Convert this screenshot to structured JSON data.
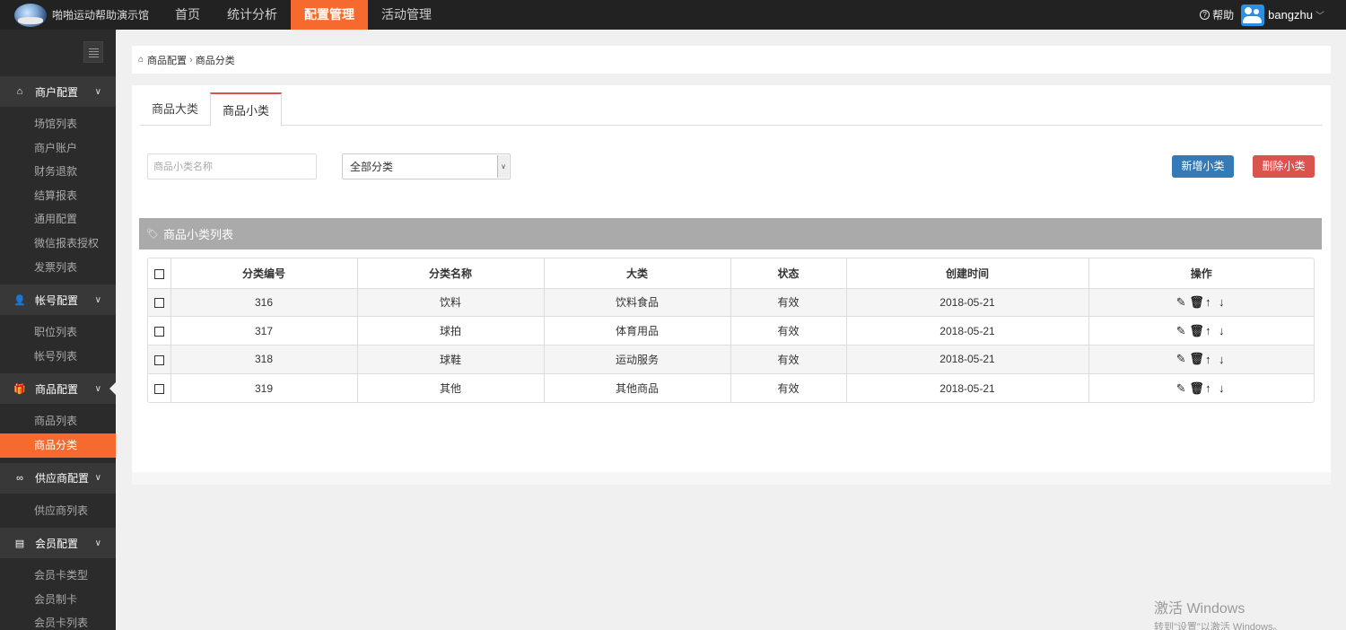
{
  "app": {
    "logo_text": "啪啪运动帮助演示馆",
    "nav": [
      {
        "label": "首页"
      },
      {
        "label": "统计分析"
      },
      {
        "label": "配置管理"
      },
      {
        "label": "活动管理"
      }
    ],
    "help_label": "帮助",
    "username": "bangzhu"
  },
  "sidebar": {
    "groups": [
      {
        "label": "商户配置",
        "icon": "home-icon",
        "items": [
          "场馆列表",
          "商户账户",
          "财务退款",
          "结算报表",
          "通用配置",
          "微信报表授权",
          "发票列表"
        ]
      },
      {
        "label": "帐号配置",
        "icon": "user-icon",
        "items": [
          "职位列表",
          "帐号列表"
        ]
      },
      {
        "label": "商品配置",
        "icon": "gift-icon",
        "items": [
          "商品列表",
          "商品分类"
        ]
      },
      {
        "label": "供应商配置",
        "icon": "link-icon",
        "items": [
          "供应商列表"
        ]
      },
      {
        "label": "会员配置",
        "icon": "id-card-icon",
        "items": [
          "会员卡类型",
          "会员制卡",
          "会员卡列表"
        ]
      }
    ]
  },
  "breadcrumb": {
    "parent": "商品配置",
    "current": "商品分类"
  },
  "tabs": [
    {
      "label": "商品大类"
    },
    {
      "label": "商品小类"
    }
  ],
  "filters": {
    "name_placeholder": "商品小类名称",
    "category_selected": "全部分类"
  },
  "buttons": {
    "add": "新增小类",
    "delete": "删除小类"
  },
  "list": {
    "title": "商品小类列表",
    "columns": [
      "分类编号",
      "分类名称",
      "大类",
      "状态",
      "创建时间",
      "操作"
    ],
    "rows": [
      {
        "id": "316",
        "name": "饮料",
        "parent": "饮料食品",
        "status": "有效",
        "created": "2018-05-21"
      },
      {
        "id": "317",
        "name": "球拍",
        "parent": "体育用品",
        "status": "有效",
        "created": "2018-05-21"
      },
      {
        "id": "318",
        "name": "球鞋",
        "parent": "运动服务",
        "status": "有效",
        "created": "2018-05-21"
      },
      {
        "id": "319",
        "name": "其他",
        "parent": "其他商品",
        "status": "有效",
        "created": "2018-05-21"
      }
    ]
  },
  "watermark": {
    "title": "激活 Windows",
    "subtitle": "转到\"设置\"以激活 Windows。"
  },
  "colors": {
    "accent": "#f66a2f",
    "primary": "#337ab7",
    "danger": "#d9534f",
    "topbar": "#222222",
    "sidebar": "#2b2b2b"
  }
}
